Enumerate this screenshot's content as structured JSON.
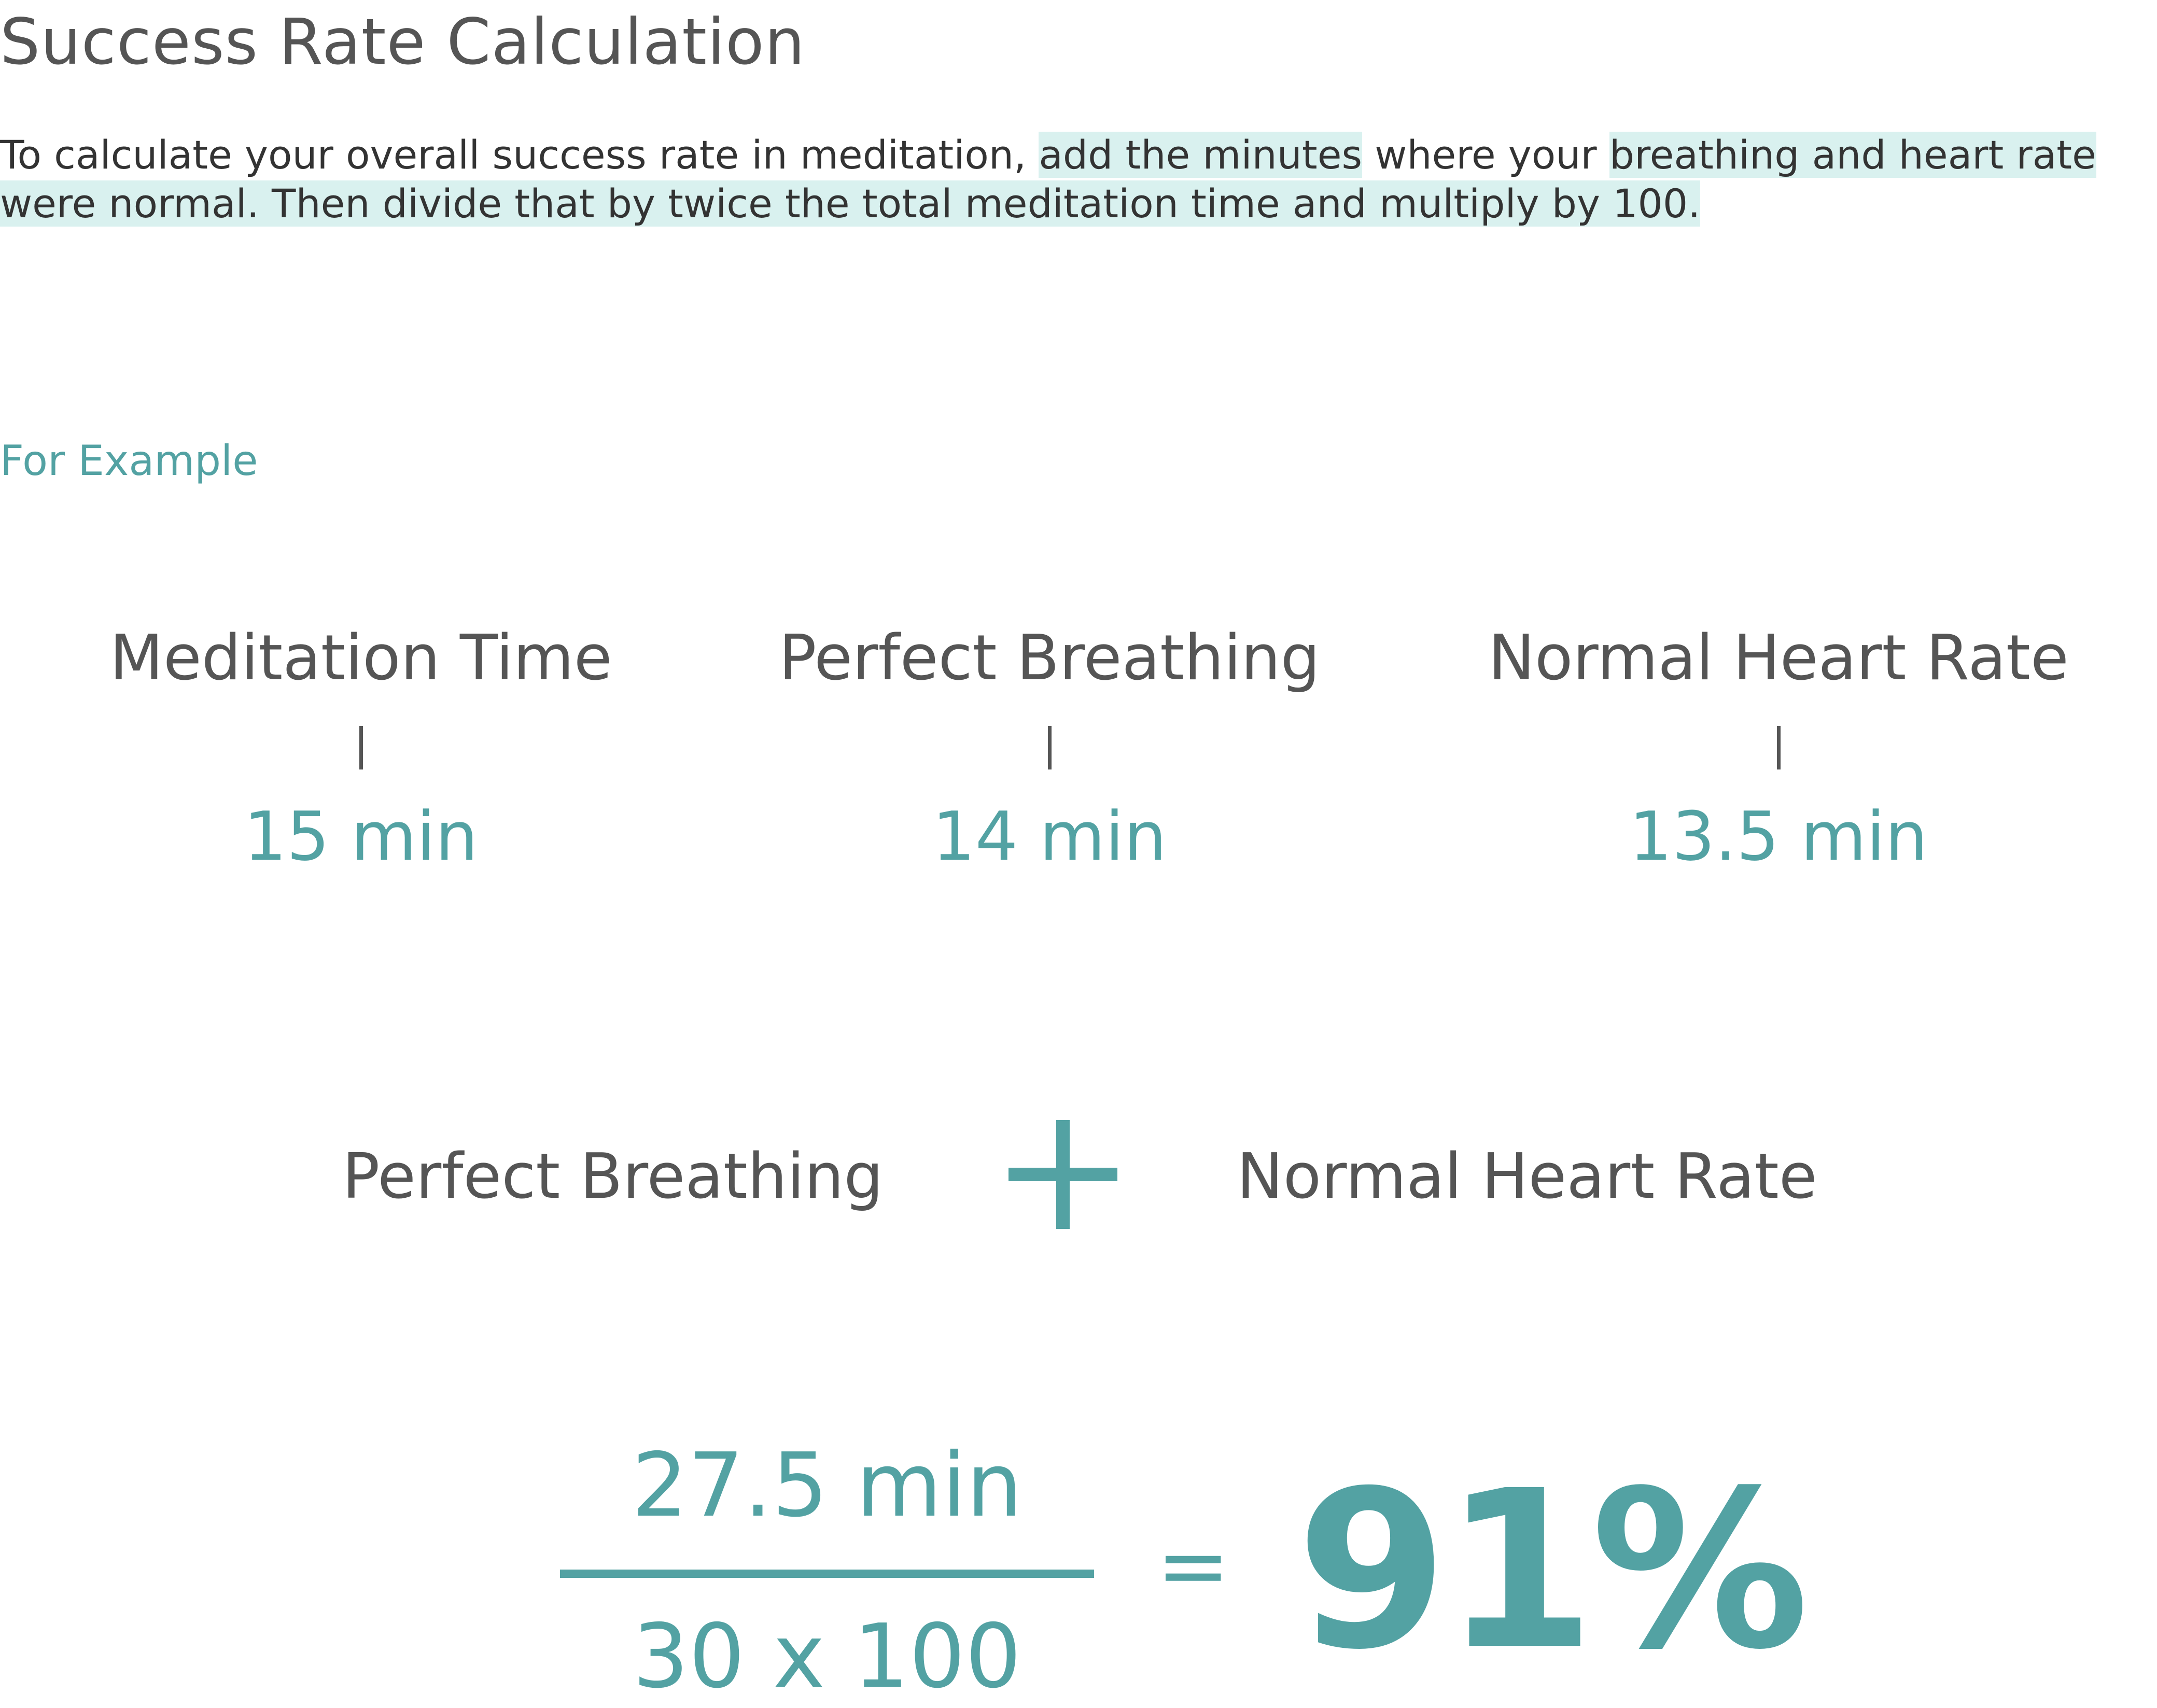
{
  "title": "Success Rate Calculation",
  "intro": {
    "part1": "To calculate your overall success rate in meditation, ",
    "highlight1": "add the minutes",
    "part2": " where your ",
    "highlight2": "breathing and heart rate were normal. Then divide that by twice the total meditation time and multiply by 100."
  },
  "example_label": "For Example",
  "columns": [
    {
      "heading": "Meditation Time",
      "value": "15 min"
    },
    {
      "heading": "Perfect Breathing",
      "value": "14 min"
    },
    {
      "heading": "Normal Heart Rate",
      "value": "13.5 min"
    }
  ],
  "sum": {
    "left": "Perfect Breathing",
    "right": "Normal Heart Rate",
    "operator_icon": "plus-icon"
  },
  "fraction": {
    "numerator": "27.5 min",
    "denominator": "30 x 100",
    "equals": "=",
    "result": "91%"
  },
  "colors": {
    "accent": "#53a2a3",
    "text": "#555555",
    "highlight": "#d9f1ef"
  }
}
